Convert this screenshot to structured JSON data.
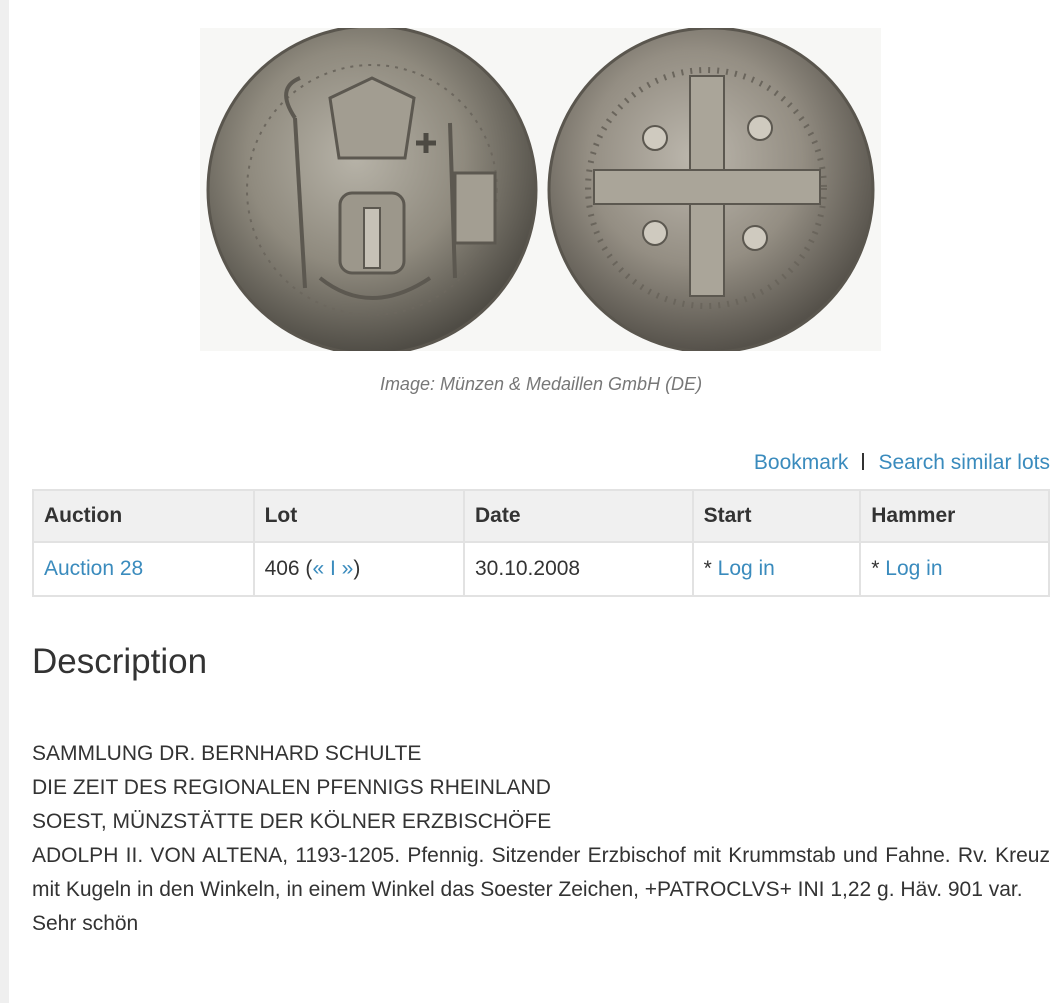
{
  "image": {
    "alt": "coin-obverse-reverse-photo",
    "caption": "Image: Münzen & Medaillen GmbH (DE)"
  },
  "actions": {
    "bookmark": "Bookmark",
    "search_similar": "Search similar lots"
  },
  "table": {
    "headers": [
      "Auction",
      "Lot",
      "Date",
      "Start",
      "Hammer"
    ],
    "row": {
      "auction": "Auction 28",
      "lot_number": "406 (",
      "lot_prev": "«",
      "lot_sep": " I ",
      "lot_next": "»",
      "lot_close": ")",
      "date": "30.10.2008",
      "start_prefix": "* ",
      "start_link": "Log in",
      "hammer_prefix": "* ",
      "hammer_link": "Log in"
    }
  },
  "description": {
    "heading": "Description",
    "lines": [
      "SAMMLUNG DR. BERNHARD SCHULTE",
      "DIE ZEIT DES REGIONALEN PFENNIGS RHEINLAND",
      "SOEST, MÜNZSTÄTTE DER KÖLNER ERZBISCHÖFE",
      "ADOLPH II. VON ALTENA, 1193-1205. Pfennig. Sitzender Erzbischof mit Krummstab und Fahne. Rv. Kreuz mit Kugeln in den Winkeln, in einem Winkel das Soester Zeichen, +PATROCLVS+ INI 1,22 g. Häv. 901 var.",
      "Sehr schön"
    ]
  },
  "colors": {
    "link": "#3a8bbd",
    "text": "#333333",
    "caption": "#777777",
    "table_header_bg": "#f0f0f0",
    "table_border": "#e2e2e2"
  }
}
